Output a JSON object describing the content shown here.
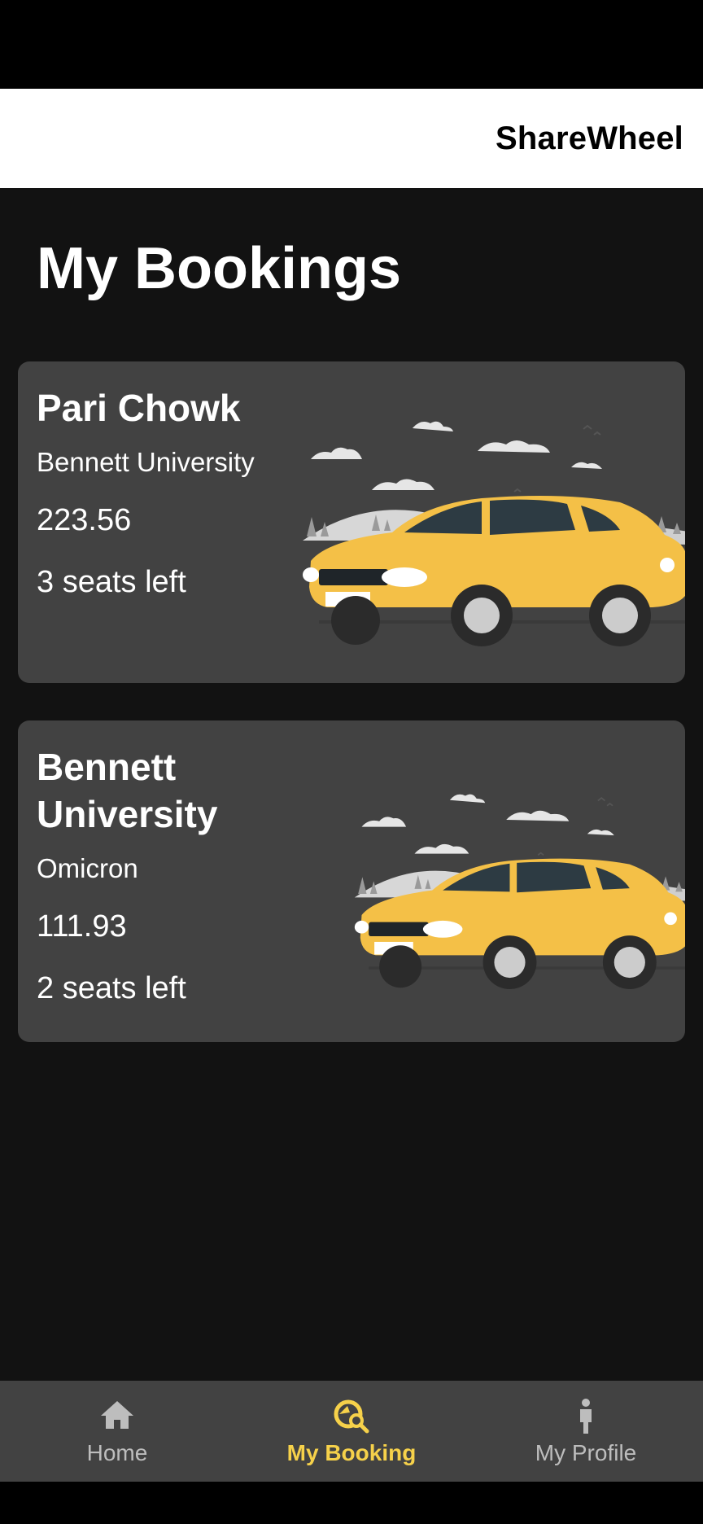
{
  "app": {
    "title": "ShareWheel"
  },
  "page": {
    "title": "My Bookings"
  },
  "bookings": [
    {
      "title": "Pari Chowk",
      "subtitle": "Bennett University",
      "price": "223.56",
      "seats": "3 seats left"
    },
    {
      "title": "Bennett University",
      "subtitle": "Omicron",
      "price": "111.93",
      "seats": "2 seats left"
    }
  ],
  "nav": {
    "items": [
      {
        "label": "Home",
        "icon": "home-icon",
        "active": false
      },
      {
        "label": "My Booking",
        "icon": "booking-search-icon",
        "active": true
      },
      {
        "label": "My Profile",
        "icon": "person-icon",
        "active": false
      }
    ]
  },
  "colors": {
    "accent": "#f6d14a",
    "card": "#424242",
    "background": "#121212",
    "car": "#f4c047"
  }
}
